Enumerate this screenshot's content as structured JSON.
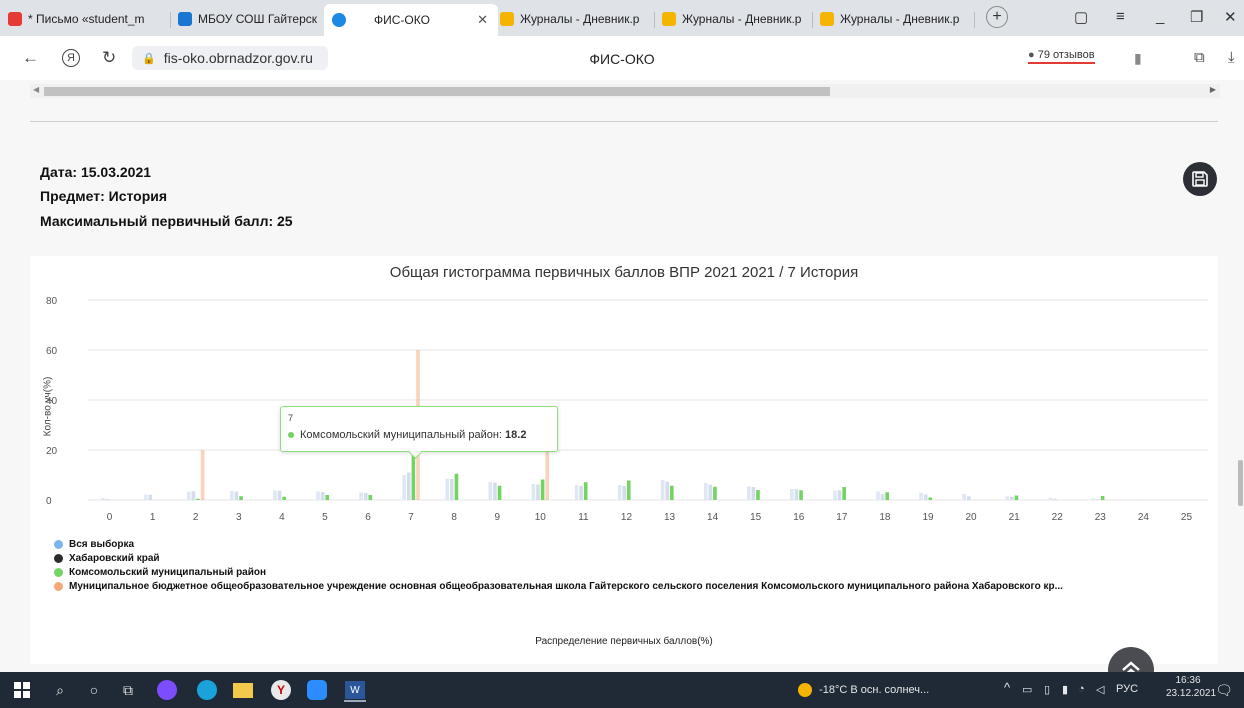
{
  "browser": {
    "tabs": [
      {
        "label": "* Письмо «student_m",
        "color": "#e53935"
      },
      {
        "label": "МБОУ СОШ Гайтерск",
        "color": "#1976d2"
      },
      {
        "label": "ФИС-ОКО",
        "color": "#1e88e5"
      },
      {
        "label": "Журналы - Дневник.р",
        "color": "#3d8fd6"
      },
      {
        "label": "Журналы - Дневник.р",
        "color": "#3d8fd6"
      },
      {
        "label": "Журналы - Дневник.р",
        "color": "#3d8fd6"
      }
    ],
    "url": "fis-oko.obrnadzor.gov.ru",
    "page_title": "ФИС-ОКО",
    "reviews": "79 отзывов"
  },
  "info": {
    "date": "Дата: 15.03.2021",
    "subject": "Предмет: История",
    "max_score": "Максимальный первичный балл: 25"
  },
  "chart_data": {
    "type": "bar",
    "title": "Общая гистограмма первичных баллов ВПР 2021 2021 / 7 История",
    "xlabel": "Распределение первичных баллов(%)",
    "ylabel": "Кол-во уч(%)",
    "ylim": [
      0,
      80
    ],
    "yticks": [
      0,
      20,
      40,
      60,
      80
    ],
    "categories": [
      "0",
      "1",
      "2",
      "3",
      "4",
      "5",
      "6",
      "7",
      "8",
      "9",
      "10",
      "11",
      "12",
      "13",
      "14",
      "15",
      "16",
      "17",
      "18",
      "19",
      "20",
      "21",
      "22",
      "23",
      "24",
      "25"
    ],
    "series": [
      {
        "name": "Вся выборка",
        "color": "#dfe7f5",
        "values": [
          0.8,
          2.2,
          3.4,
          3.6,
          3.8,
          3.4,
          3,
          10,
          8.5,
          7.2,
          6.4,
          6,
          6,
          8,
          6.8,
          5.5,
          4.4,
          3.7,
          3.4,
          2.9,
          2.4,
          1.5,
          0.9,
          0.6,
          0.3,
          0.1
        ]
      },
      {
        "name": "Хабаровский край",
        "color": "#d4ddea",
        "values": [
          0.4,
          2.1,
          3.5,
          3.4,
          3.7,
          3.2,
          2.8,
          11,
          8.4,
          7,
          6.2,
          5.6,
          5.6,
          7.4,
          6.1,
          5.2,
          4.3,
          3.9,
          2.4,
          2.2,
          1.5,
          1.2,
          0.5,
          0.3,
          0.2,
          0.1
        ]
      },
      {
        "name": "Комсомольский муниципальный район",
        "color": "#73d463",
        "values": [
          0,
          0,
          0.5,
          1.5,
          1.3,
          2,
          2,
          18.2,
          10.5,
          5.7,
          8.2,
          7.1,
          7.8,
          5.7,
          5.3,
          4,
          3.9,
          5.2,
          3.1,
          1,
          0,
          1.8,
          0,
          1.6,
          0,
          0
        ]
      },
      {
        "name": "Муниципальное бюджетное общеобразовательное учреждение основная общеобразовательная школа Гайтерского сельского поселения Комсомольского муниципального района Хабаровского кр...",
        "color": "#f5a77a",
        "values": [
          0,
          0,
          20,
          0,
          0,
          0,
          0,
          60,
          0,
          0,
          20,
          0,
          0,
          0,
          0,
          0,
          0,
          0,
          0,
          0,
          0,
          0,
          0,
          0,
          0,
          0
        ]
      }
    ],
    "tooltip": {
      "x": "7",
      "series": "Комсомольский муниципальный район",
      "value": "18.2"
    }
  },
  "taskbar": {
    "weather": "-18°C  В осн. солнеч...",
    "lang": "РУС",
    "time": "16:36",
    "date": "23.12.2021"
  }
}
